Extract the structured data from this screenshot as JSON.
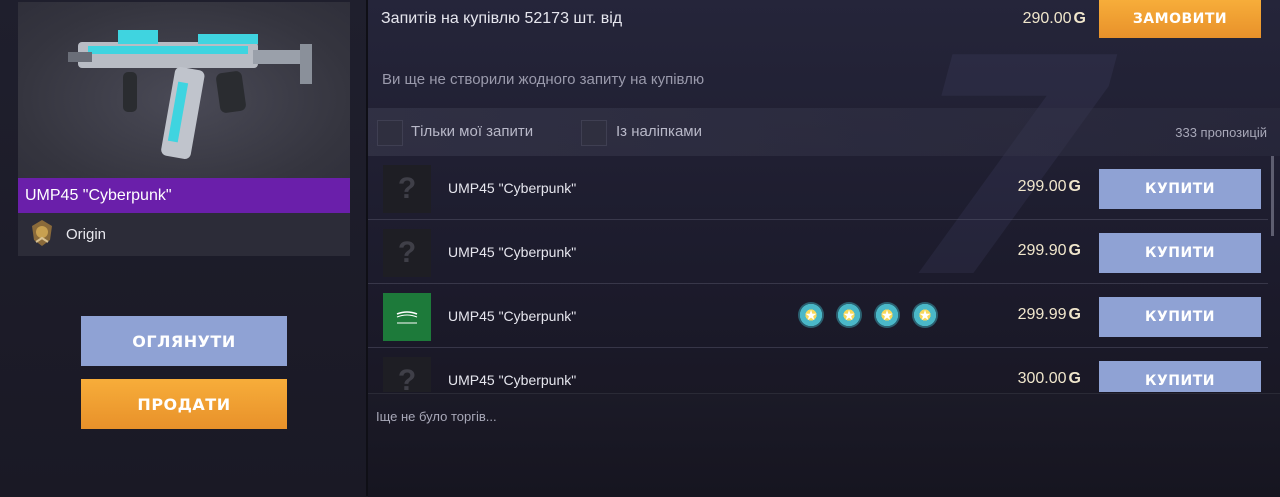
{
  "item": {
    "name": "UMP45 \"Cyberpunk\"",
    "origin": "Origin",
    "rarity_color": "#6a1faa"
  },
  "actions": {
    "inspect_label": "ОГЛЯНУТИ",
    "sell_label": "ПРОДАТИ"
  },
  "requests": {
    "summary": "Запитів на купівлю 52173 шт. від",
    "min_price": "290.00",
    "order_label": "ЗАМОВИТИ",
    "none_text": "Ви ще не створили жодного запиту на купівлю"
  },
  "filters": {
    "only_mine": "Тільки мої запити",
    "with_stickers": "Із наліпками",
    "offers_count": "333 пропозицій"
  },
  "currency_symbol": "G",
  "offers": [
    {
      "name": "UMP45 \"Cyberpunk\"",
      "price": "299.00",
      "buy_label": "КУПИТИ",
      "thumb": "unknown"
    },
    {
      "name": "UMP45 \"Cyberpunk\"",
      "price": "299.90",
      "buy_label": "КУПИТИ",
      "thumb": "unknown"
    },
    {
      "name": "UMP45 \"Cyberpunk\"",
      "price": "299.99",
      "buy_label": "КУПИТИ",
      "thumb": "flag-saudi-arabia",
      "stickers": 4
    },
    {
      "name": "UMP45 \"Cyberpunk\"",
      "price": "300.00",
      "buy_label": "КУПИТИ",
      "thumb": "unknown"
    }
  ],
  "history": {
    "empty_text": "Іще не було торгів..."
  },
  "colors": {
    "accent_orange": "#f0a030",
    "button_blue": "#8fa2d4",
    "rarity_purple": "#6a1faa"
  }
}
